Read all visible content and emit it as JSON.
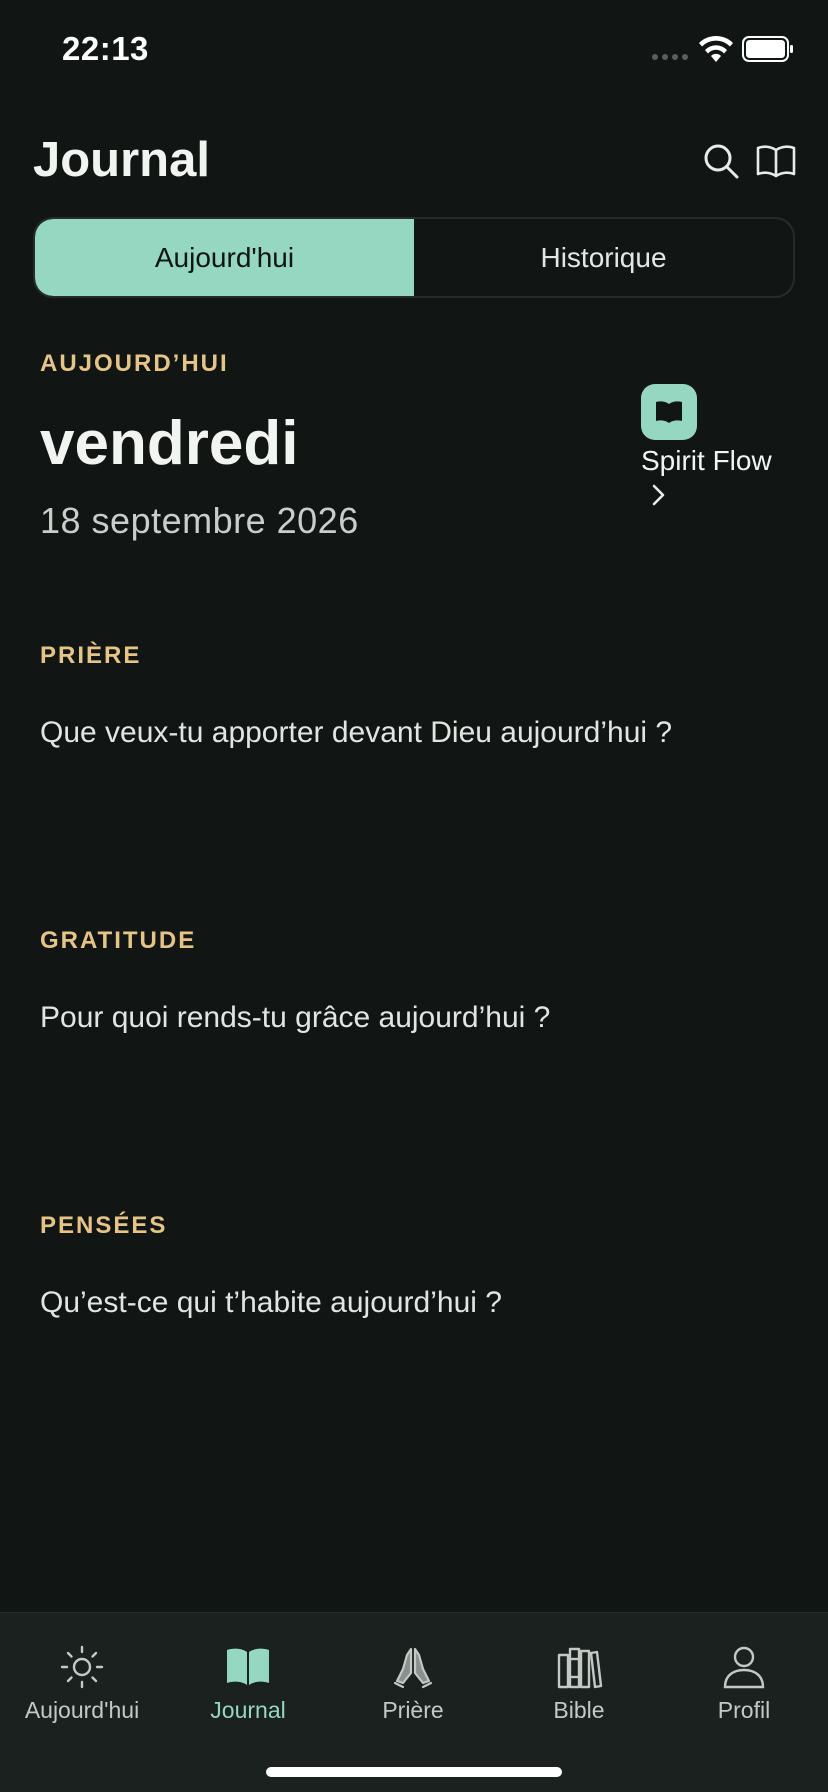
{
  "status_bar": {
    "time": "22:13"
  },
  "header": {
    "title": "Journal"
  },
  "segmented": {
    "today": "Aujourd'hui",
    "history": "Historique"
  },
  "today": {
    "label": "AUJOURD’HUI",
    "weekday": "vendredi",
    "date": "18 septembre 2026"
  },
  "spirit_flow": {
    "label": "Spirit Flow"
  },
  "sections": [
    {
      "label": "PRIÈRE",
      "prompt": "Que veux-tu apporter devant Dieu aujourd’hui ?"
    },
    {
      "label": "GRATITUDE",
      "prompt": "Pour quoi rends-tu grâce aujourd’hui ?"
    },
    {
      "label": "PENSÉES",
      "prompt": "Qu’est-ce qui t’habite aujourd’hui ?"
    }
  ],
  "tabs": [
    {
      "label": "Aujourd'hui",
      "icon": "sun-icon"
    },
    {
      "label": "Journal",
      "icon": "book-icon",
      "active": true
    },
    {
      "label": "Prière",
      "icon": "praying-hands-icon"
    },
    {
      "label": "Bible",
      "icon": "books-icon"
    },
    {
      "label": "Profil",
      "icon": "person-icon"
    }
  ],
  "colors": {
    "accent": "#95D7C0",
    "section_label": "#E6C488",
    "background": "#111614"
  }
}
